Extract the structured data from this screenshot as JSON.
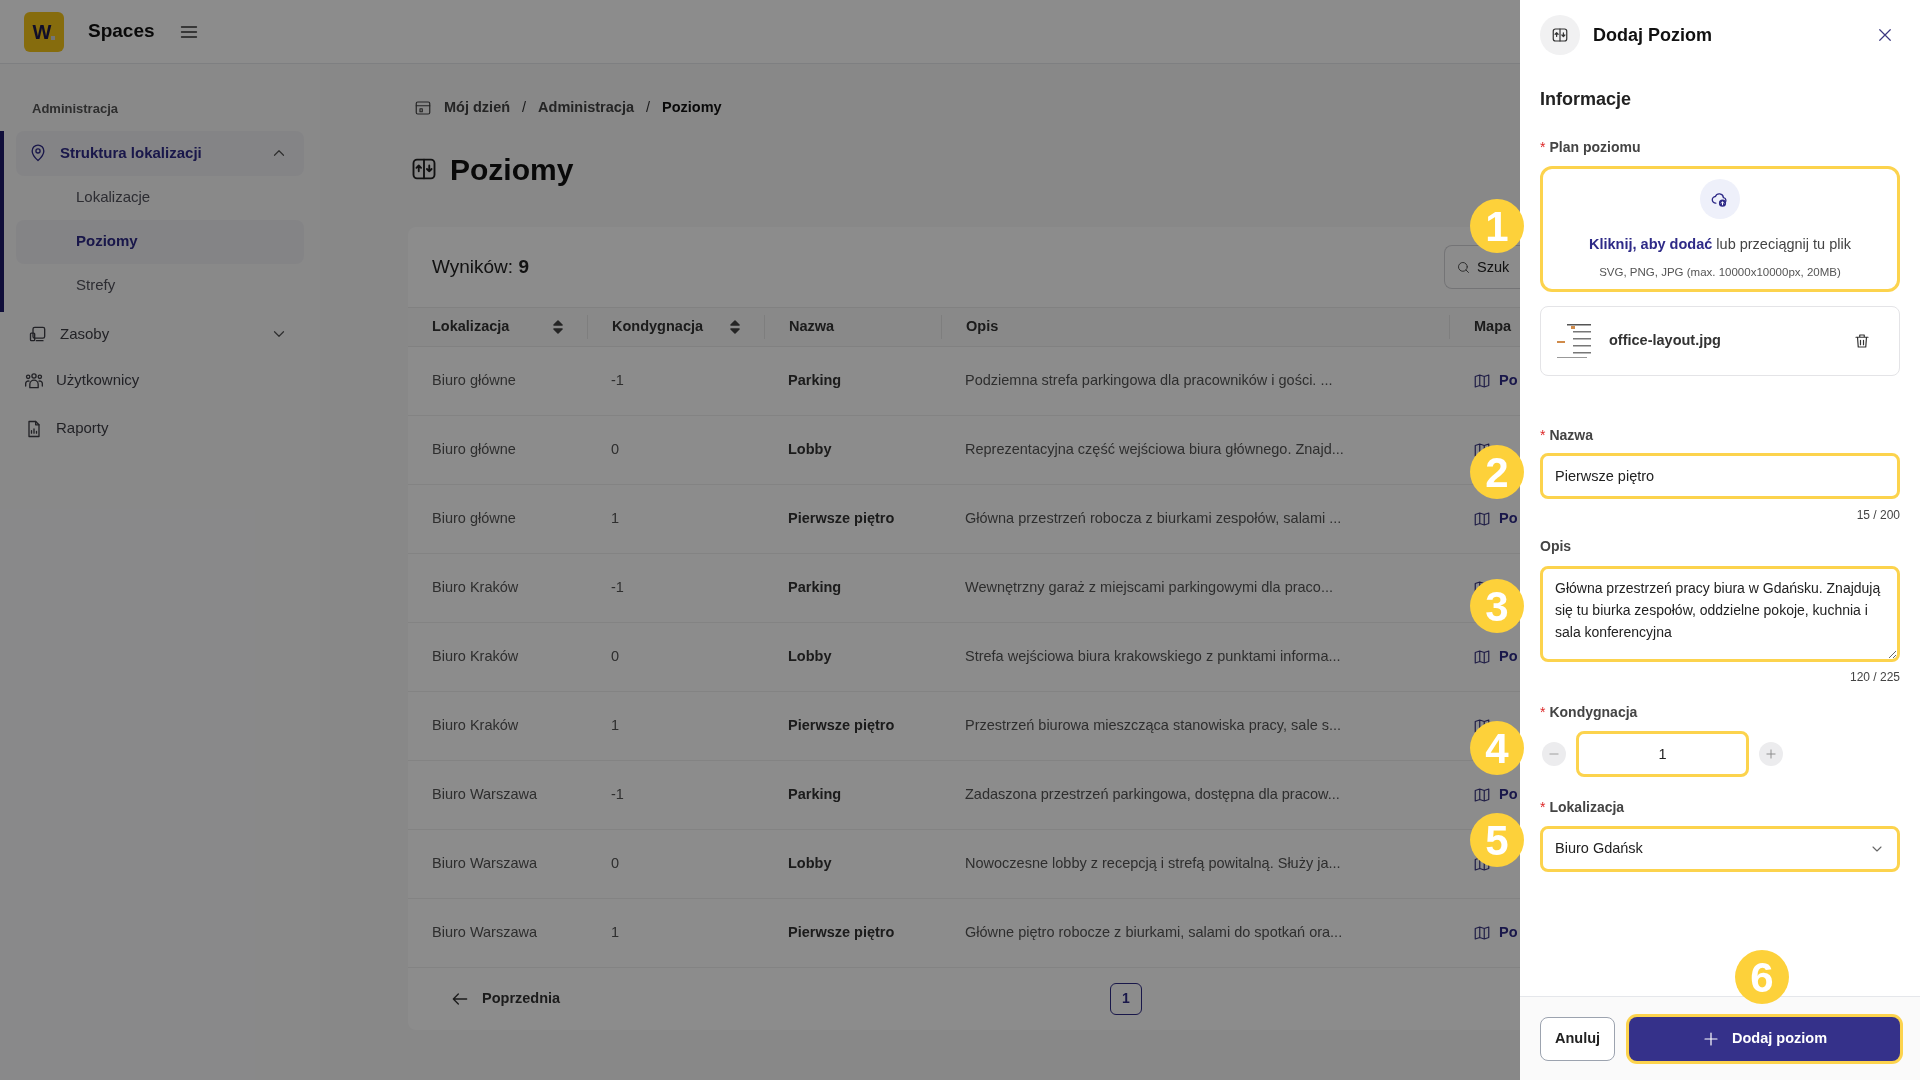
{
  "app": {
    "logo": "W",
    "name": "Spaces"
  },
  "sidebar": {
    "section": "Administracja",
    "items": [
      {
        "kind": "group",
        "label": "Struktura lokalizacji",
        "active": true,
        "expanded": true,
        "children": [
          {
            "label": "Lokalizacje",
            "selected": false
          },
          {
            "label": "Poziomy",
            "selected": true
          },
          {
            "label": "Strefy",
            "selected": false
          }
        ]
      },
      {
        "kind": "group",
        "label": "Zasoby",
        "active": false,
        "expanded": false
      },
      {
        "kind": "link",
        "label": "Użytkownicy",
        "active": false
      },
      {
        "kind": "link",
        "label": "Raporty",
        "active": false
      }
    ]
  },
  "breadcrumbs": [
    {
      "label": "Mój dzień"
    },
    {
      "separator": "/",
      "label": "Administracja"
    },
    {
      "separator": "/",
      "label": "Poziomy"
    }
  ],
  "page_title": "Poziomy",
  "table": {
    "results": "Wyników: **9**",
    "search": {
      "placeholder": "Szuk"
    },
    "columns": [
      {
        "label": "Lokalizacja",
        "sortable": true
      },
      {
        "label": "Kondygnacja",
        "sortable": true
      },
      {
        "label": "Nazwa",
        "sortable": false
      },
      {
        "label": "Opis",
        "sortable": false
      },
      {
        "label": "Mapa",
        "sortable": false
      }
    ],
    "rows": [
      {
        "location": "Biuro główne",
        "floor": "-1",
        "name": "Parking",
        "description": "Podziemna strefa parkingowa dla pracowników i gości. ...",
        "map": "Po"
      },
      {
        "location": "Biuro główne",
        "floor": "0",
        "name": "Lobby",
        "description": "Reprezentacyjna część wejściowa biura głównego. Znajd..."
      },
      {
        "location": "Biuro główne",
        "floor": "1",
        "name": "Pierwsze piętro",
        "description": "Główna przestrzeń robocza z biurkami zespołów, salami ...",
        "map": "Po"
      },
      {
        "location": "Biuro Kraków",
        "floor": "-1",
        "name": "Parking",
        "description": "Wewnętrzny garaż z miejscami parkingowymi dla praco..."
      },
      {
        "location": "Biuro Kraków",
        "floor": "0",
        "name": "Lobby",
        "description": "Strefa wejściowa biura krakowskiego z punktami informa...",
        "map": "Po"
      },
      {
        "location": "Biuro Kraków",
        "floor": "1",
        "name": "Pierwsze piętro",
        "description": "Przestrzeń biurowa mieszcząca stanowiska pracy, sale s..."
      },
      {
        "location": "Biuro Warszawa",
        "floor": "-1",
        "name": "Parking",
        "description": "Zadaszona przestrzeń parkingowa, dostępna dla pracow...",
        "map": "Po"
      },
      {
        "location": "Biuro Warszawa",
        "floor": "0",
        "name": "Lobby",
        "description": "Nowoczesne lobby z recepcją i strefą powitalną. Służy ja..."
      },
      {
        "location": "Biuro Warszawa",
        "floor": "1",
        "name": "Pierwsze piętro",
        "description": "Główne piętro robocze z biurkami, salami do spotkań ora...",
        "map": "Po"
      }
    ],
    "pagination": {
      "previous": "Poprzednia",
      "pages": [
        {
          "label": "1",
          "selected": true
        }
      ]
    }
  },
  "panel": {
    "title": "Dodaj Poziom",
    "section": "Informacje",
    "plan": {
      "label": "Plan poziomu",
      "mark": "*",
      "highlighted": true,
      "prompt": "**Kliknij, aby dodać** lub przeciągnij tu plik",
      "hint": "SVG, PNG, JPG (max. 10000x10000px, 20MB)",
      "file": "office-layout.jpg"
    },
    "name": {
      "label": "Nazwa",
      "mark": "*",
      "highlighted": true,
      "value": "Pierwsze piętro",
      "counter": "15 / 200"
    },
    "description": {
      "label": "Opis",
      "highlighted": true,
      "value": "Główna przestrzeń pracy biura w Gdańsku. Znajdują się tu biurka zespołów, oddzielne pokoje, kuchnia i sala konferencyjna",
      "counter": "120 / 225"
    },
    "floor": {
      "label": "Kondygnacja",
      "mark": "*",
      "highlighted": true,
      "value": "1"
    },
    "location": {
      "label": "Lokalizacja",
      "mark": "*",
      "highlighted": true,
      "value": "Biuro Gdańsk"
    },
    "cancel": "Anuluj",
    "submit": {
      "label": "Dodaj poziom",
      "highlighted": true
    }
  },
  "annotations": [
    {
      "number": "1"
    },
    {
      "number": "2"
    },
    {
      "number": "3"
    },
    {
      "number": "4"
    },
    {
      "number": "5"
    },
    {
      "number": "6"
    }
  ]
}
